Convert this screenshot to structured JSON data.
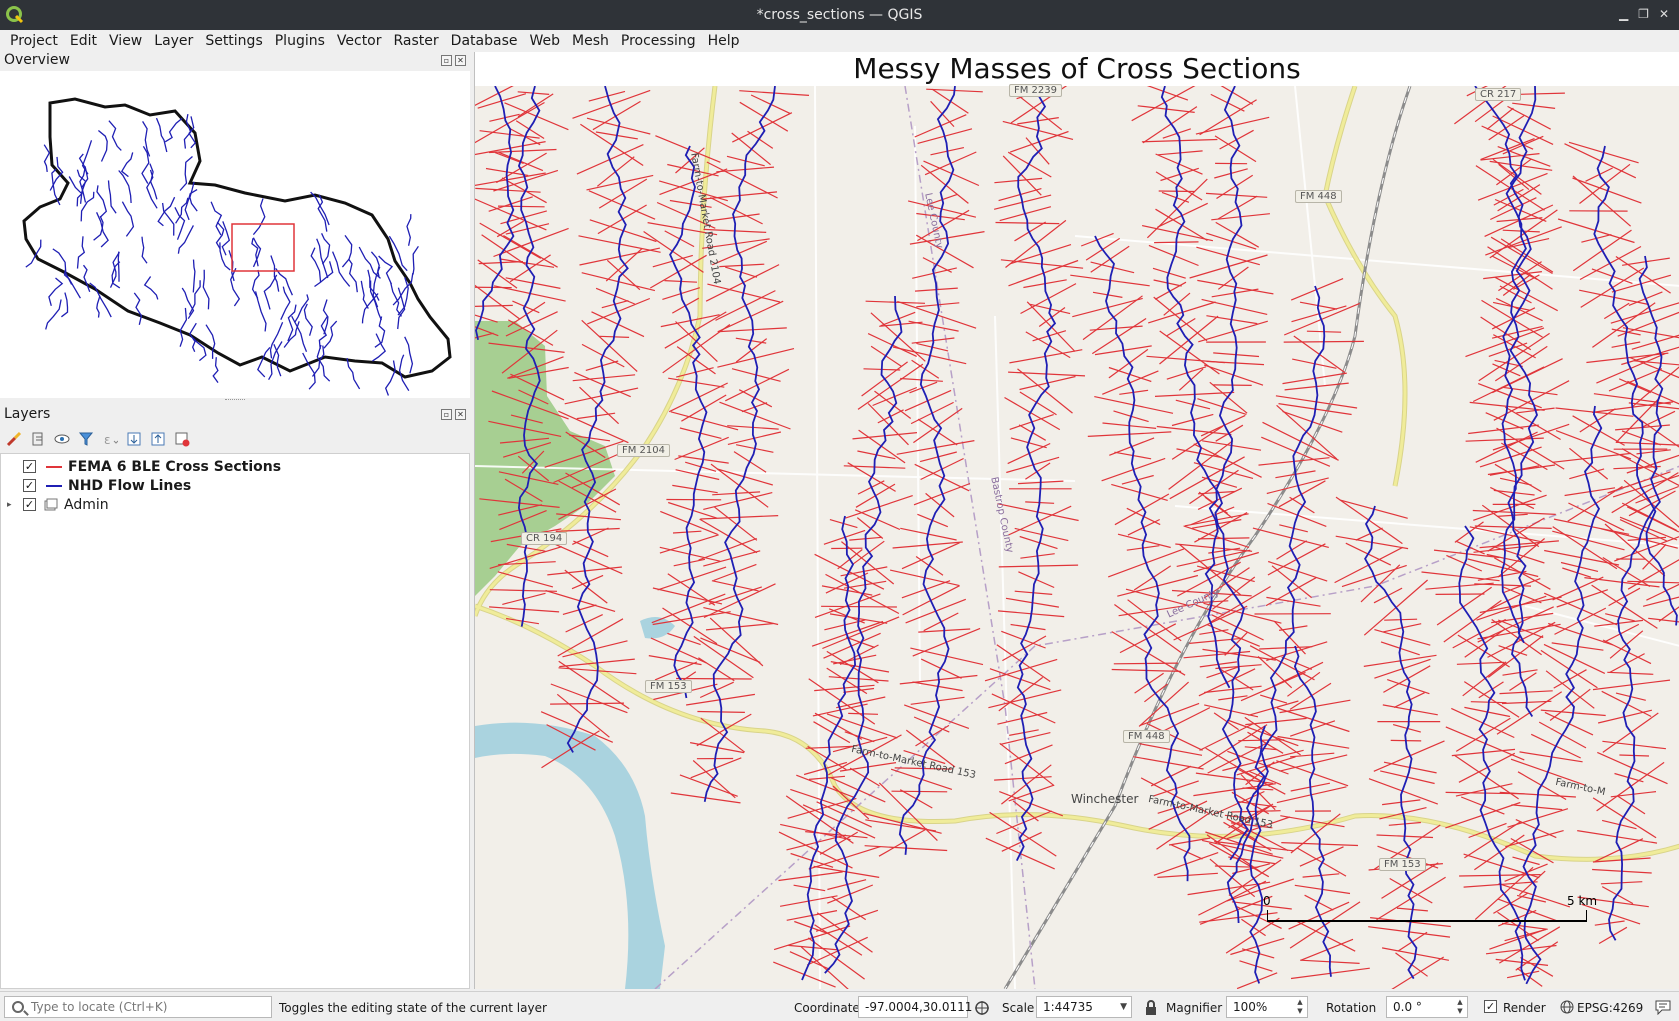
{
  "window": {
    "title": "*cross_sections — QGIS"
  },
  "menubar": [
    "Project",
    "Edit",
    "View",
    "Layer",
    "Settings",
    "Plugins",
    "Vector",
    "Raster",
    "Database",
    "Web",
    "Mesh",
    "Processing",
    "Help"
  ],
  "overview_panel": {
    "title": "Overview"
  },
  "layers_panel": {
    "title": "Layers",
    "layers": [
      {
        "name": "FEMA 6 BLE Cross Sections",
        "checked": true,
        "color": "#e0353a",
        "bold": true
      },
      {
        "name": "NHD Flow Lines",
        "checked": true,
        "color": "#1f1fb4",
        "bold": true
      },
      {
        "name": "Admin",
        "checked": true,
        "color": "",
        "bold": false,
        "group": true
      }
    ]
  },
  "map": {
    "title": "Messy Masses of Cross Sections",
    "road_labels": [
      "FM 2239",
      "CR 217",
      "FM 448",
      "FM 2104",
      "CR 194",
      "FM 153",
      "FM 448",
      "FM 153"
    ],
    "vertical_road_labels": [
      "Farm-to-Market Road 2104",
      "Farm-to-Market Road 153",
      "Farm-to-Market Road 153",
      "Farm-to-M"
    ],
    "county_labels": [
      "Lee County",
      "Bastrop County",
      "Lee County"
    ],
    "place_labels": [
      "Winchester"
    ],
    "scale_start": "0",
    "scale_end": "5 km",
    "colors": {
      "cross_section": "#e0353a",
      "flowline": "#1f1fb4",
      "basemap": "#f2efe9",
      "park": "#a7cf92",
      "road_yellow": "#f0ec9a",
      "rail": "#8c8c8c"
    }
  },
  "statusbar": {
    "locator_placeholder": "Type to locate (Ctrl+K)",
    "message": "Toggles the editing state of the current layer",
    "coordinate_label": "Coordinate",
    "coordinate_value": "-97.0004,30.0111",
    "scale_label": "Scale",
    "scale_value": "1:44735",
    "magnifier_label": "Magnifier",
    "magnifier_value": "100%",
    "rotation_label": "Rotation",
    "rotation_value": "0.0 °",
    "render_label": "Render",
    "crs": "EPSG:4269"
  }
}
